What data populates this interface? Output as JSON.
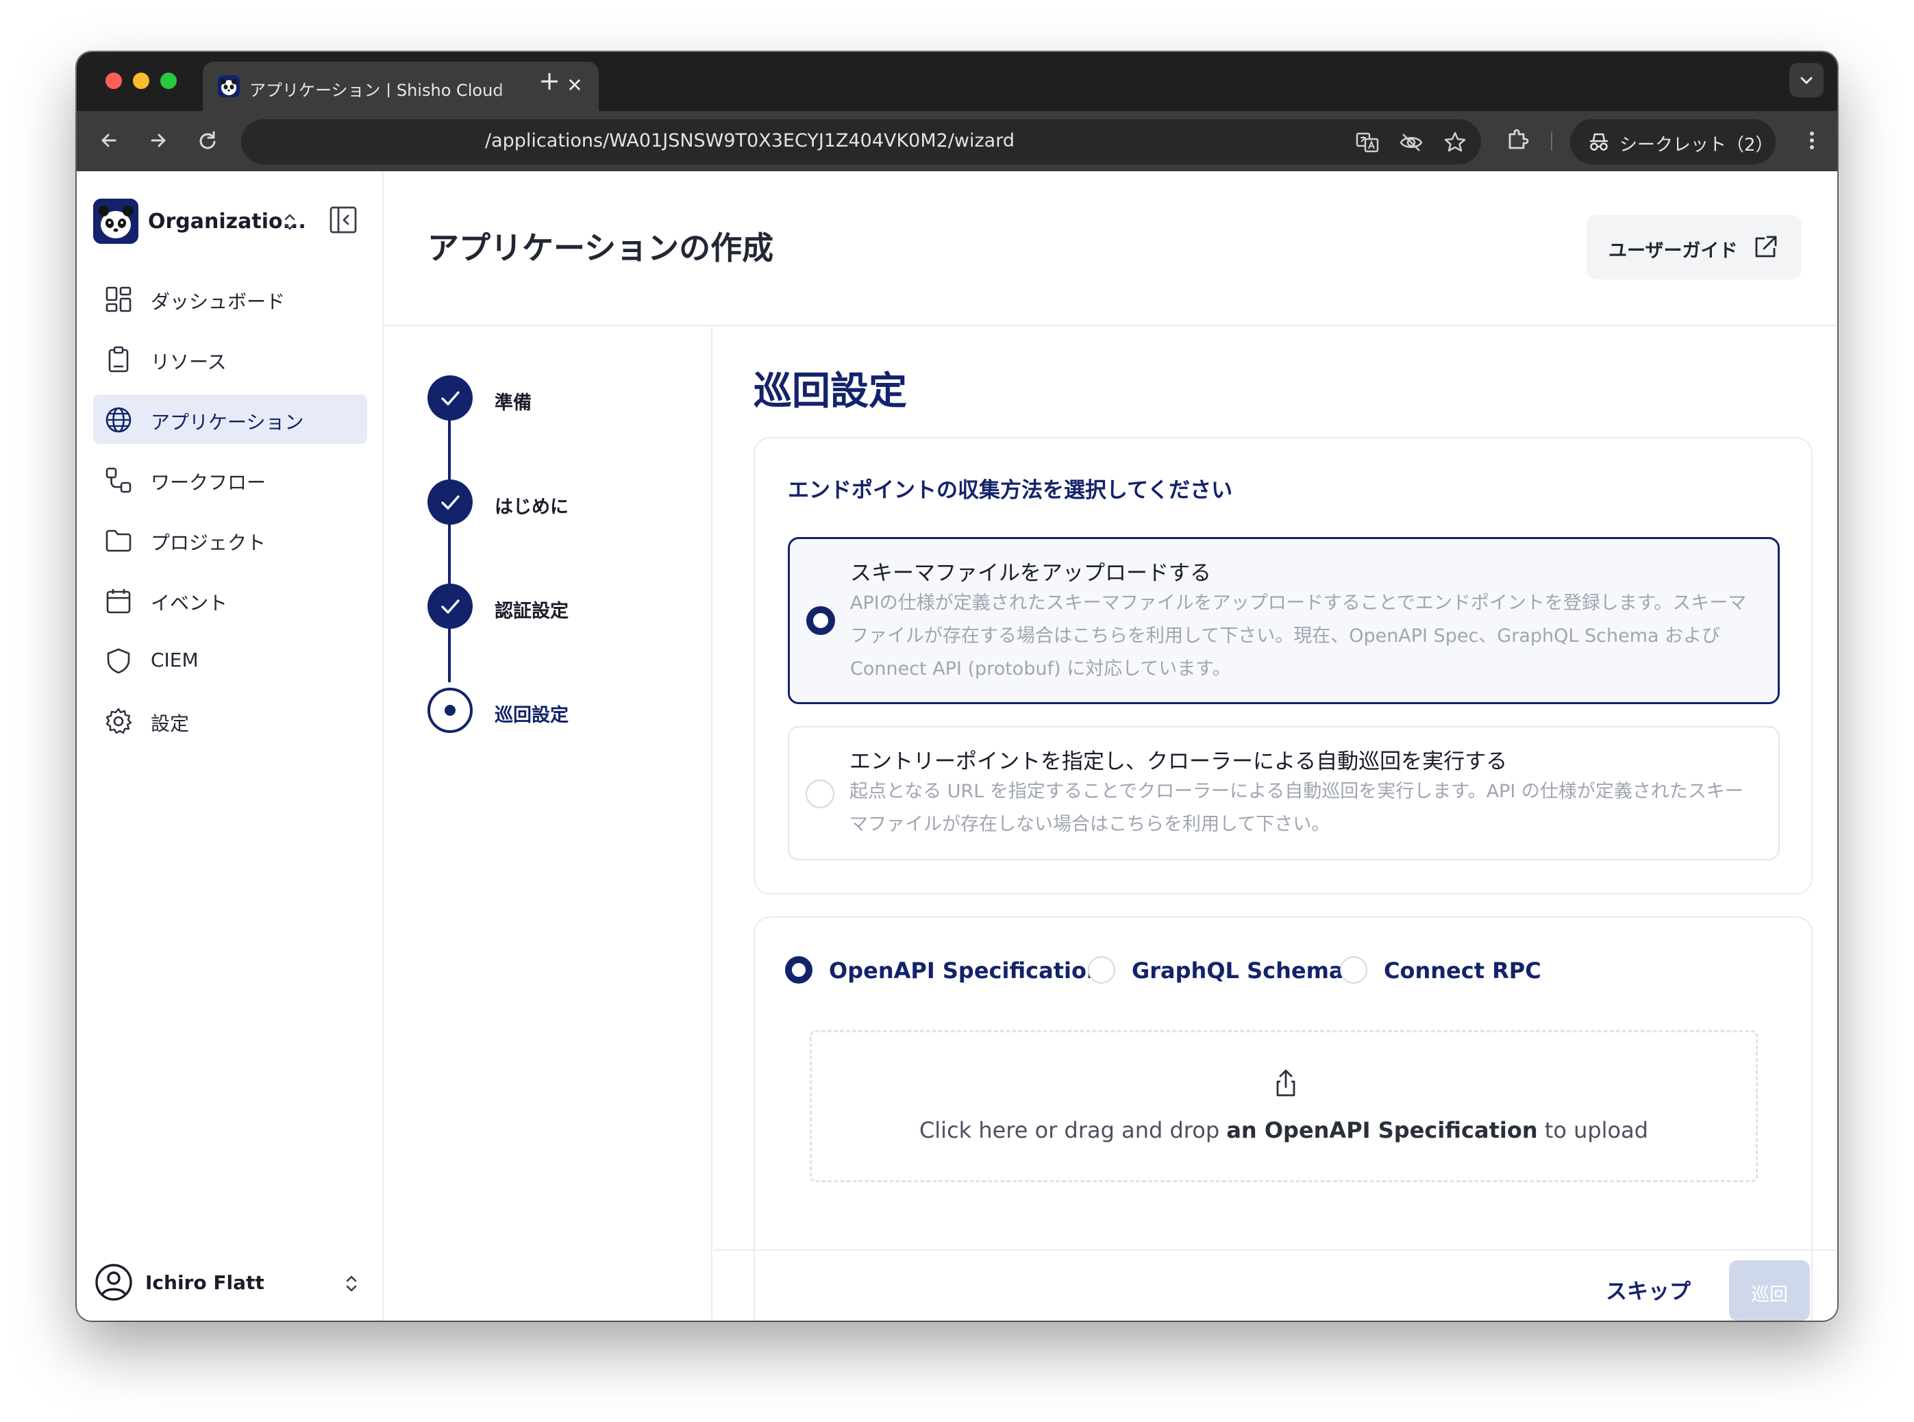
{
  "browser": {
    "tab_title": "アプリケーション | Shisho Cloud",
    "tab_close": "✕",
    "new_tab": "+",
    "url": "/applications/WA01JSNSW9T0X3ECYJ1Z404VK0M2/wizard",
    "incognito_label": "シークレット（2）"
  },
  "sidebar": {
    "org_name": "Organizatio...",
    "items": [
      {
        "label": "ダッシュボード",
        "icon": "dashboard-icon"
      },
      {
        "label": "リソース",
        "icon": "resource-clipboard-icon"
      },
      {
        "label": "アプリケーション",
        "icon": "globe-icon",
        "active": true
      },
      {
        "label": "ワークフロー",
        "icon": "workflow-icon"
      },
      {
        "label": "プロジェクト",
        "icon": "folder-icon"
      },
      {
        "label": "イベント",
        "icon": "calendar-icon"
      },
      {
        "label": "CIEM",
        "icon": "shield-icon"
      },
      {
        "label": "設定",
        "icon": "gear-icon"
      }
    ],
    "user_name": "Ichiro Flatt"
  },
  "header": {
    "title": "アプリケーションの作成",
    "guide_label": "ユーザーガイド"
  },
  "steps": [
    {
      "label": "準備",
      "status": "done"
    },
    {
      "label": "はじめに",
      "status": "done"
    },
    {
      "label": "認証設定",
      "status": "done"
    },
    {
      "label": "巡回設定",
      "status": "current"
    }
  ],
  "main": {
    "section_title": "巡回設定",
    "method_card": {
      "title": "エンドポイントの収集方法を選択してください",
      "options": [
        {
          "title": "スキーマファイルをアップロードする",
          "desc": "APIの仕様が定義されたスキーマファイルをアップロードすることでエンドポイントを登録します。スキーマファイルが存在する場合はこちらを利用して下さい。現在、OpenAPI Spec、GraphQL Schema および Connect API (protobuf) に対応しています。",
          "selected": true
        },
        {
          "title": "エントリーポイントを指定し、クローラーによる自動巡回を実行する",
          "desc": "起点となる URL を指定することでクローラーによる自動巡回を実行します。API の仕様が定義されたスキーマファイルが存在しない場合はこちらを利用して下さい。",
          "selected": false
        }
      ]
    },
    "upload_card": {
      "spec_types": [
        {
          "label": "OpenAPI Specification",
          "selected": true
        },
        {
          "label": "GraphQL Schema",
          "selected": false
        },
        {
          "label": "Connect RPC",
          "selected": false
        }
      ],
      "drop_prefix": "Click here or drag and drop ",
      "drop_bold": "an OpenAPI Specification",
      "drop_suffix": " to upload"
    }
  },
  "footer": {
    "skip_label": "スキップ",
    "patrol_label": "巡回"
  },
  "colors": {
    "primary": "#13236b",
    "active_bg": "#e6ebf7",
    "disabled_btn": "#cfd8ea",
    "chrome_dark": "#1f1f1f",
    "chrome_toolbar": "#3c3c3c"
  }
}
